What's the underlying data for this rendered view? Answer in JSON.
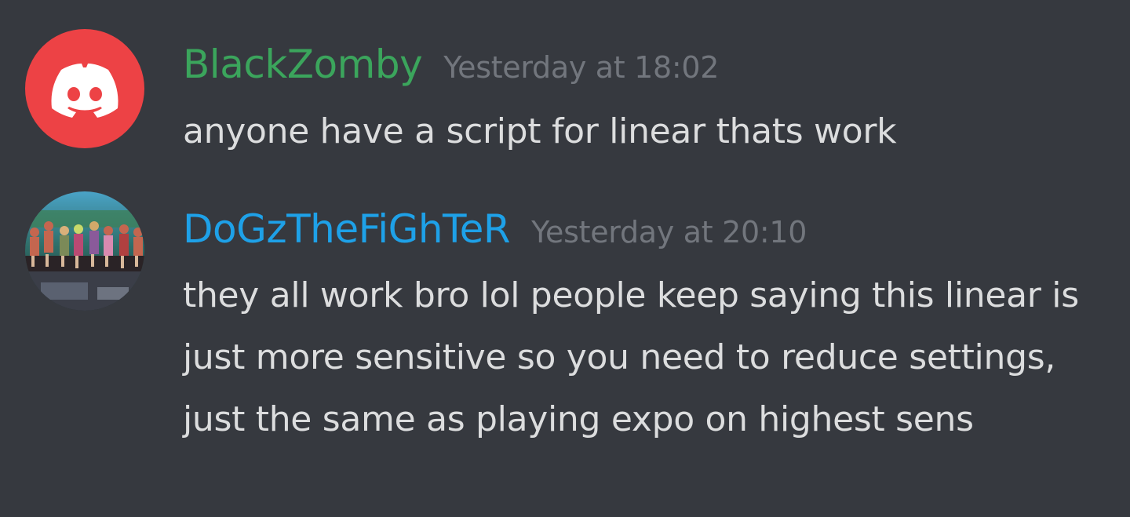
{
  "messages": [
    {
      "username": "BlackZomby",
      "username_color": "#3ba55c",
      "timestamp": "Yesterday at 18:02",
      "avatar": "discord-logo-icon",
      "text": "anyone have a script for linear thats work"
    },
    {
      "username": "DoGzTheFiGhTeR",
      "username_color": "#1ea1e8",
      "timestamp": "Yesterday at 20:10",
      "avatar": "user-photo-avatar",
      "text": "they all work bro lol people keep saying this linear is just more sensitive so you need to reduce settings, just the same as playing expo on highest sens"
    }
  ]
}
